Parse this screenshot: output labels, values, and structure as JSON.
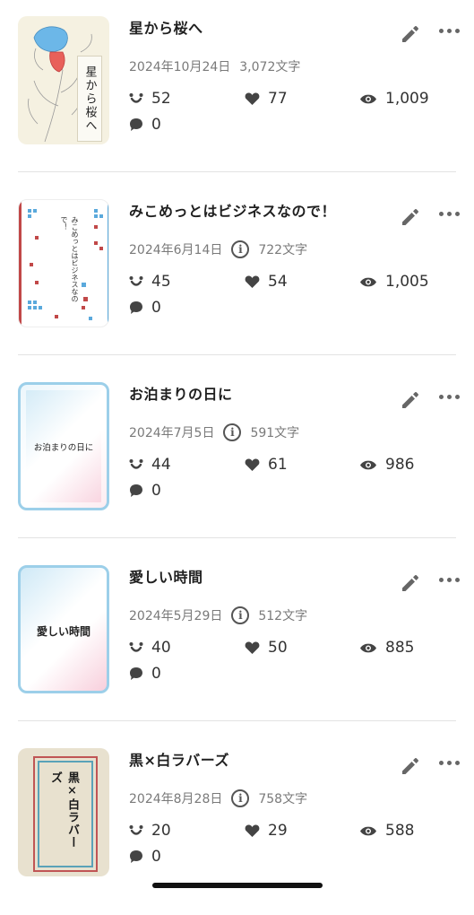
{
  "icons": {
    "edit": "pencil-icon",
    "more": "ellipsis-icon",
    "reactions": "smile-icon",
    "likes": "heart-icon",
    "views": "eye-icon",
    "comments": "speech-bubble-icon",
    "info": "info-icon"
  },
  "colors": {
    "accent_blue": "#5aa9dc",
    "accent_pink": "#ef7fa3",
    "accent_red": "#c14848"
  },
  "works": [
    {
      "title": "星から桜へ",
      "cover_text": "星から桜へ",
      "date": "2024年10月24日",
      "chars": "3,072文字",
      "has_info": false,
      "reactions": "52",
      "likes": "77",
      "views": "1,009",
      "comments": "0"
    },
    {
      "title": "みこめっとはビジネスなので！",
      "cover_text": "みこめっとはビジネスなので！",
      "date": "2024年6月14日",
      "chars": "722文字",
      "has_info": true,
      "info_symbol": "i",
      "reactions": "45",
      "likes": "54",
      "views": "1,005",
      "comments": "0"
    },
    {
      "title": "お泊まりの日に",
      "cover_text": "お泊まりの日に",
      "date": "2024年7月5日",
      "chars": "591文字",
      "has_info": true,
      "info_symbol": "i",
      "reactions": "44",
      "likes": "61",
      "views": "986",
      "comments": "0"
    },
    {
      "title": "愛しい時間",
      "cover_text": "愛しい時間",
      "date": "2024年5月29日",
      "chars": "512文字",
      "has_info": true,
      "info_symbol": "i",
      "reactions": "40",
      "likes": "50",
      "views": "885",
      "comments": "0"
    },
    {
      "title": "黒×白ラバーズ",
      "cover_text": "黒×白ラバーズ",
      "date": "2024年8月28日",
      "chars": "758文字",
      "has_info": true,
      "info_symbol": "i",
      "reactions": "20",
      "likes": "29",
      "views": "588",
      "comments": "0"
    }
  ]
}
